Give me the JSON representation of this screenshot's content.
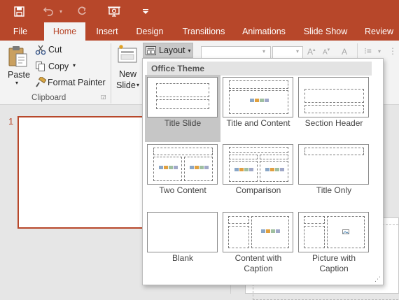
{
  "colors": {
    "accent": "#b7472a",
    "selected_tile": "#c6c6c6"
  },
  "quick_access": {
    "save_icon": "save-icon",
    "undo_icon": "undo-icon",
    "redo_icon": "redo-icon",
    "present_icon": "present-from-beginning-icon",
    "customize_icon": "customize-qat-icon"
  },
  "tabs": [
    "File",
    "Home",
    "Insert",
    "Design",
    "Transitions",
    "Animations",
    "Slide Show",
    "Review"
  ],
  "active_tab": "Home",
  "clipboard": {
    "paste": "Paste",
    "cut": "Cut",
    "copy": "Copy",
    "format_painter": "Format Painter",
    "group_label": "Clipboard"
  },
  "slides": {
    "new_slide_line1": "New",
    "new_slide_line2": "Slide",
    "layout": "Layout"
  },
  "gallery": {
    "header": "Office Theme",
    "selected": "Title Slide",
    "layouts": [
      {
        "name": "Title Slide",
        "caption": [
          "Title Slide"
        ]
      },
      {
        "name": "Title and Content",
        "caption": [
          "Title and Content"
        ]
      },
      {
        "name": "Section Header",
        "caption": [
          "Section Header"
        ]
      },
      {
        "name": "Two Content",
        "caption": [
          "Two Content"
        ]
      },
      {
        "name": "Comparison",
        "caption": [
          "Comparison"
        ]
      },
      {
        "name": "Title Only",
        "caption": [
          "Title Only"
        ]
      },
      {
        "name": "Blank",
        "caption": [
          "Blank"
        ]
      },
      {
        "name": "Content with Caption",
        "caption": [
          "Content with",
          "Caption"
        ]
      },
      {
        "name": "Picture with Caption",
        "caption": [
          "Picture with",
          "Caption"
        ]
      }
    ]
  },
  "slide_panel": {
    "slide_number": "1"
  }
}
